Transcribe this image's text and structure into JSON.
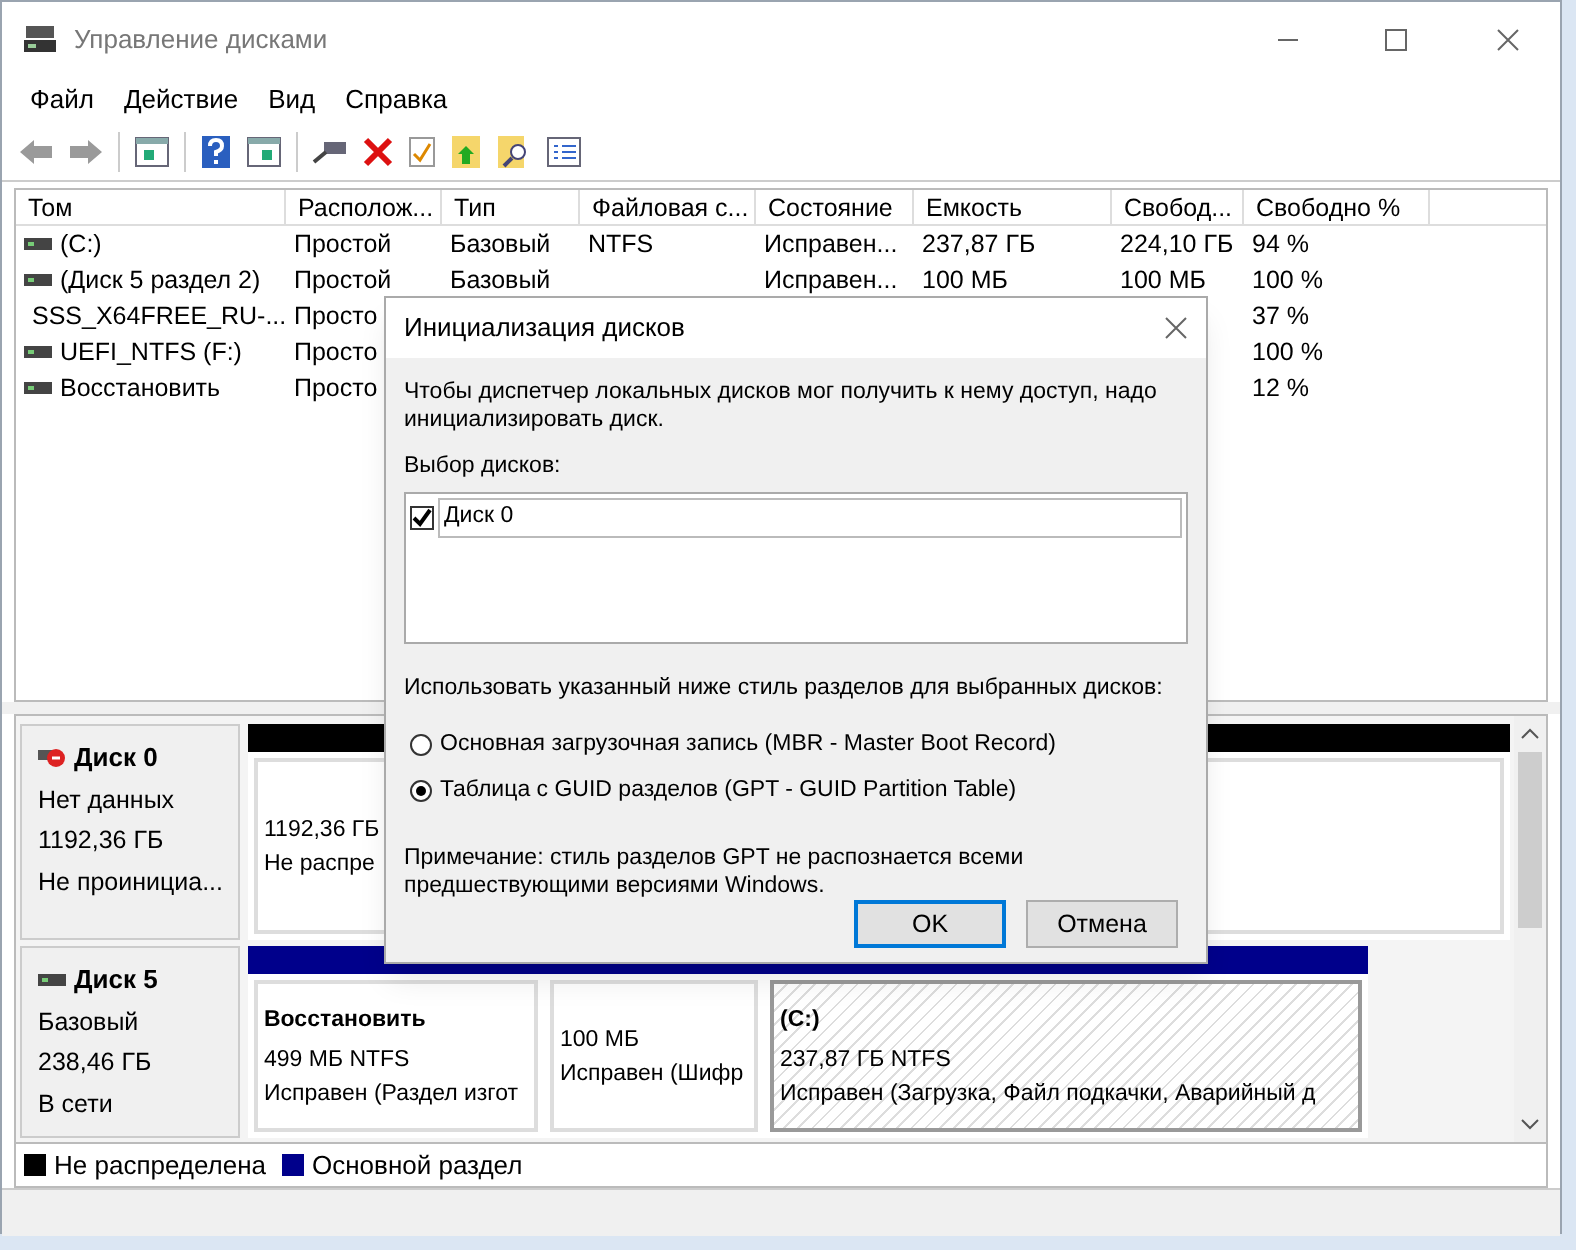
{
  "window": {
    "title": "Управление дисками"
  },
  "menu": [
    "Файл",
    "Действие",
    "Вид",
    "Справка"
  ],
  "table": {
    "columns": [
      "Том",
      "Располож...",
      "Тип",
      "Файловая с...",
      "Состояние",
      "Емкость",
      "Свобод...",
      "Свободно %"
    ],
    "rows": [
      {
        "cells": [
          "(C:)",
          "Простой",
          "Базовый",
          "NTFS",
          "Исправен...",
          "237,87 ГБ",
          "224,10 ГБ",
          "94 %"
        ]
      },
      {
        "cells": [
          "(Диск 5 раздел 2)",
          "Простой",
          "Базовый",
          null,
          "Исправен...",
          "100 МБ",
          "100 МБ",
          "100 %"
        ]
      },
      {
        "cells": [
          "SSS_X64FREE_RU-...",
          "Просто",
          null,
          null,
          null,
          null,
          null,
          "37 %"
        ]
      },
      {
        "cells": [
          "UEFI_NTFS (F:)",
          "Просто",
          null,
          null,
          null,
          null,
          null,
          "100 %"
        ]
      },
      {
        "cells": [
          "Восстановить",
          "Просто",
          null,
          null,
          null,
          null,
          null,
          "12 %"
        ]
      }
    ]
  },
  "disks": [
    {
      "name": "Диск 0",
      "alert": true,
      "lines": [
        "Нет данных",
        "1192,36 ГБ",
        "Не проинициа..."
      ],
      "partitions": [
        {
          "kind": "unallocated",
          "selected": false,
          "lines": [
            "1192,36 ГБ",
            "Не распре"
          ]
        }
      ]
    },
    {
      "name": "Диск 5",
      "alert": false,
      "lines": [
        "Базовый",
        "238,46 ГБ",
        "В сети"
      ],
      "partitions": [
        {
          "kind": "primary",
          "selected": false,
          "title": "Восстановить",
          "lines": [
            "499 МБ NTFS",
            "Исправен (Раздел изгот"
          ]
        },
        {
          "kind": "primary",
          "selected": false,
          "lines": [
            "100 МБ",
            "Исправен (Шифр"
          ]
        },
        {
          "kind": "primary",
          "selected": true,
          "title": "(C:)",
          "lines": [
            "237,87 ГБ NTFS",
            "Исправен (Загрузка, Файл подкачки, Аварийный д"
          ]
        }
      ]
    }
  ],
  "legend": [
    {
      "label": "Не распределена",
      "color": "#000000"
    },
    {
      "label": "Основной раздел",
      "color": "#00008b"
    }
  ],
  "dialog": {
    "title": "Инициализация дисков",
    "text": "Чтобы диспетчер локальных дисков мог получить к нему доступ, надо инициализировать диск.",
    "list_label": "Выбор дисков:",
    "disks": [
      {
        "label": "Диск 0",
        "checked": true
      }
    ],
    "style_label": "Использовать указанный ниже стиль разделов для выбранных дисков:",
    "options": [
      {
        "label": "Основная загрузочная запись (MBR - Master Boot Record)",
        "selected": false
      },
      {
        "label": "Таблица с GUID разделов (GPT - GUID Partition Table)",
        "selected": true
      }
    ],
    "note": "Примечание: стиль разделов GPT не распознается всеми предшествующими версиями Windows.",
    "buttons": [
      {
        "label": "OK",
        "default": true
      },
      {
        "label": "Отмена",
        "default": false
      }
    ]
  }
}
